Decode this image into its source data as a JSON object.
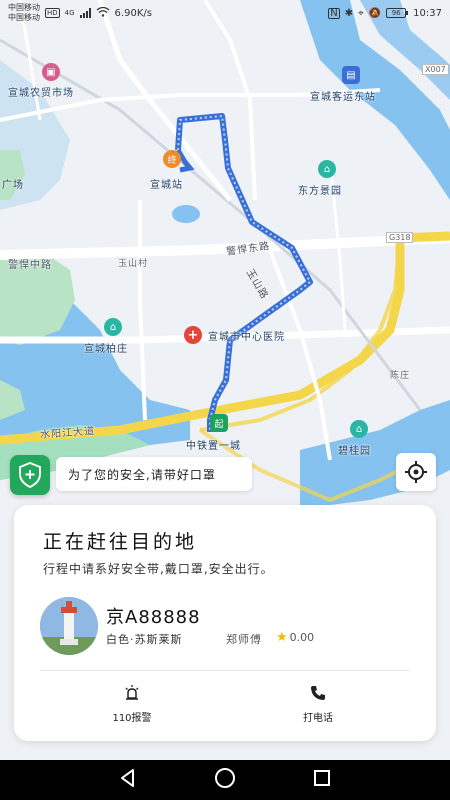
{
  "status_bar": {
    "carrier_1": "中国移动",
    "carrier_2": "中国移动",
    "hd": "HD",
    "network": "4G",
    "speed": "6.90K/s",
    "battery": "96",
    "time": "10:37"
  },
  "map": {
    "labels": {
      "farmer_market": "宣城农贸市场",
      "bus_station": "宣城客运东站",
      "end_station": "宣城站",
      "dongfang_garden": "东方景园",
      "plaza": "广场",
      "xingyu_east_road": "警悍东路",
      "xingyu_mid_road": "警悍中路",
      "yushan_village": "玉山村",
      "yushan_road": "玉山路",
      "g318": "G318",
      "x007": "X007",
      "baizhuang": "宣城柏庄",
      "central_hospital": "宣城市中心医院",
      "chenzhuang": "陈庄",
      "shuiyangjiang": "水阳江大道",
      "zhongtie": "中铁置一城",
      "biguiyuan": "碧桂园"
    },
    "start_marker": "起",
    "end_marker": "终",
    "route_color": "#3a6fd8"
  },
  "safety_tip": "为了您的安全,请带好口罩",
  "trip": {
    "status": "正在赶往目的地",
    "hint": "行程中请系好安全带,戴口罩,安全出行。",
    "plate": "京A88888",
    "car": "白色·苏斯莱斯",
    "driver": "郑师傅",
    "rating": "0.00",
    "actions": {
      "police": "110报警",
      "call": "打电话"
    }
  },
  "colors": {
    "accent_green": "#22a85a",
    "star": "#f5b800"
  }
}
